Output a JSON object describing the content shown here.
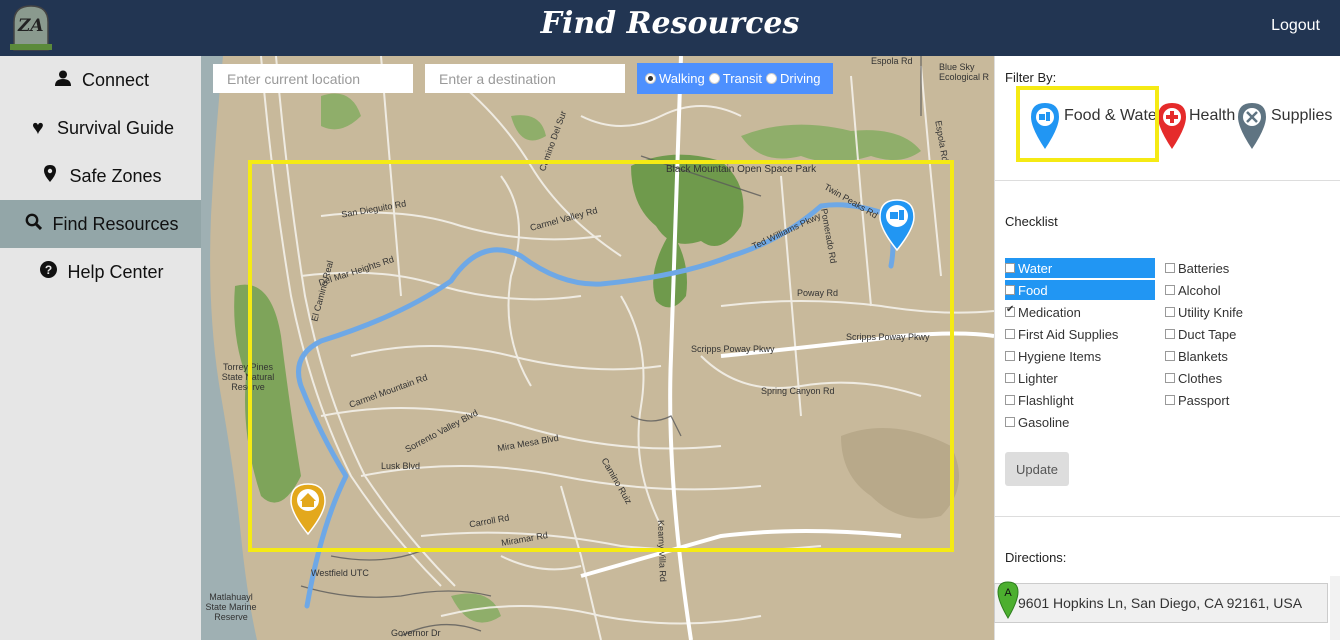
{
  "header": {
    "title": "Find Resources",
    "logout": "Logout",
    "logo_text": "ZA"
  },
  "sidebar": {
    "items": [
      {
        "label": "Connect",
        "icon": "user-icon",
        "glyph": "👤"
      },
      {
        "label": "Survival Guide",
        "icon": "heart-icon",
        "glyph": "♥"
      },
      {
        "label": "Safe Zones",
        "icon": "map-marker-icon",
        "glyph": "●"
      },
      {
        "label": "Find Resources",
        "icon": "search-icon",
        "glyph": "⌕",
        "active": true
      },
      {
        "label": "Help Center",
        "icon": "question-icon",
        "glyph": "?"
      }
    ]
  },
  "map": {
    "origin_placeholder": "Enter current location",
    "destination_placeholder": "Enter a destination",
    "modes": [
      "Walking",
      "Transit",
      "Driving"
    ],
    "selected_mode": "Walking",
    "labels": [
      "Black Mountain Open Space Park",
      "Carmel Valley Rd",
      "Twin Peaks Rd",
      "Ted Williams Pkwy",
      "Pomerado Rd",
      "Poway Rd",
      "Scripps Poway Pkwy",
      "Spring Canyon Rd",
      "Sorrento Valley Blvd",
      "Carmel Mountain Rd",
      "Mira Mesa Blvd",
      "Miramar Rd",
      "Carroll Rd",
      "Torrey Pines State Natural Reserve",
      "Del Mar Heights Rd",
      "San Dieguito Rd",
      "El Camino Real",
      "Camino Del Sur",
      "Blue Sky Ecological R",
      "Espola Rd",
      "Westfield UTC",
      "Governor Dr",
      "Matlahuayl State Marine Reserve",
      "Kearny Villa Rd",
      "Lusk Blvd",
      "Camino Ruiz",
      "Scripps Poway Pkwy",
      "Espola Rd"
    ],
    "route_color": "#6ea8e6"
  },
  "filters": {
    "title": "Filter By:",
    "items": [
      {
        "label": "Food & Water",
        "icon": "food-water-pin-icon",
        "color": "#2196f3"
      },
      {
        "label": "Health",
        "icon": "health-pin-icon",
        "color": "#e52b2b"
      },
      {
        "label": "Supplies",
        "icon": "supplies-pin-icon",
        "color": "#5f7482"
      }
    ]
  },
  "checklist": {
    "title": "Checklist",
    "left": [
      {
        "label": "Water",
        "checked": false,
        "selected": true
      },
      {
        "label": "Food",
        "checked": false,
        "selected": true
      },
      {
        "label": "Medication",
        "checked": true,
        "selected": false
      },
      {
        "label": "First Aid Supplies",
        "checked": false,
        "selected": false
      },
      {
        "label": "Hygiene Items",
        "checked": false,
        "selected": false
      },
      {
        "label": "Lighter",
        "checked": false,
        "selected": false
      },
      {
        "label": "Flashlight",
        "checked": false,
        "selected": false
      },
      {
        "label": "Gasoline",
        "checked": false,
        "selected": false
      }
    ],
    "right": [
      {
        "label": "Batteries",
        "checked": false
      },
      {
        "label": "Alcohol",
        "checked": false
      },
      {
        "label": "Utility Knife",
        "checked": false
      },
      {
        "label": "Duct Tape",
        "checked": false
      },
      {
        "label": "Blankets",
        "checked": false
      },
      {
        "label": "Clothes",
        "checked": false
      },
      {
        "label": "Passport",
        "checked": false
      }
    ],
    "update": "Update"
  },
  "directions": {
    "title": "Directions:",
    "marker": "A",
    "address": "9601 Hopkins Ln, San Diego, CA 92161, USA"
  }
}
